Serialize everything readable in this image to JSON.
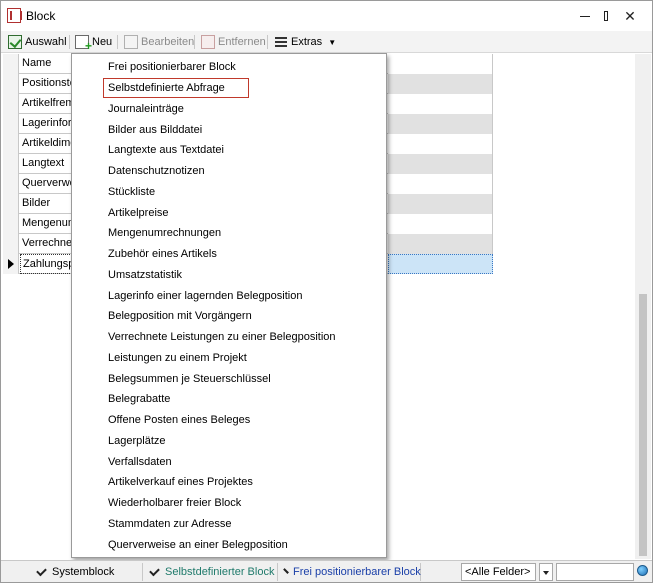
{
  "window": {
    "title": "Block"
  },
  "toolbar": {
    "auswahl": "Auswahl",
    "neu": "Neu",
    "bearbeiten": "Bearbeiten",
    "entfernen": "Entfernen",
    "extras": "Extras"
  },
  "grid": {
    "rows": [
      {
        "name": "Name"
      },
      {
        "name": "Positionstext"
      },
      {
        "name": "Artikelfremdtext"
      },
      {
        "name": "Lagerinformation"
      },
      {
        "name": "Artikeldimension"
      },
      {
        "name": "Langtext"
      },
      {
        "name": "Querverweise"
      },
      {
        "name": "Bilder"
      },
      {
        "name": "Mengenumrechnungen"
      },
      {
        "name": "Verrechnete Leistungen"
      },
      {
        "name": "Zahlungsplan"
      }
    ]
  },
  "menu": {
    "items": [
      "Frei positionierbarer Block",
      "Selbstdefinierte Abfrage",
      "Journaleinträge",
      "Bilder aus Bilddatei",
      "Langtexte aus Textdatei",
      "Datenschutznotizen",
      "Stückliste",
      "Artikelpreise",
      "Mengenumrechnungen",
      "Zubehör eines Artikels",
      "Umsatzstatistik",
      "Lagerinfo einer lagernden Belegposition",
      "Belegposition mit Vorgängern",
      "Verrechnete Leistungen zu einer Belegposition",
      "Leistungen zu einem Projekt",
      "Belegsummen je Steuerschlüssel",
      "Belegrabatte",
      "Offene Posten eines Beleges",
      "Lagerplätze",
      "Verfallsdaten",
      "Artikelverkauf eines Projektes",
      "Wiederholbarer freier Block",
      "Stammdaten zur Adresse",
      "Querverweise an einer Belegposition"
    ],
    "highlighted_index": 1
  },
  "statusbar": {
    "systemblock": "Systemblock",
    "selbstdefiniert": "Selbstdefinierter Block",
    "frei": "Frei positionierbarer Block",
    "felder": "<Alle Felder>"
  },
  "colors": {
    "selbstdefiniert_text": "#1f7a6b",
    "frei_text": "#1a3fa8",
    "highlight_border": "#c0392b",
    "current_row": "#cce4f7"
  }
}
